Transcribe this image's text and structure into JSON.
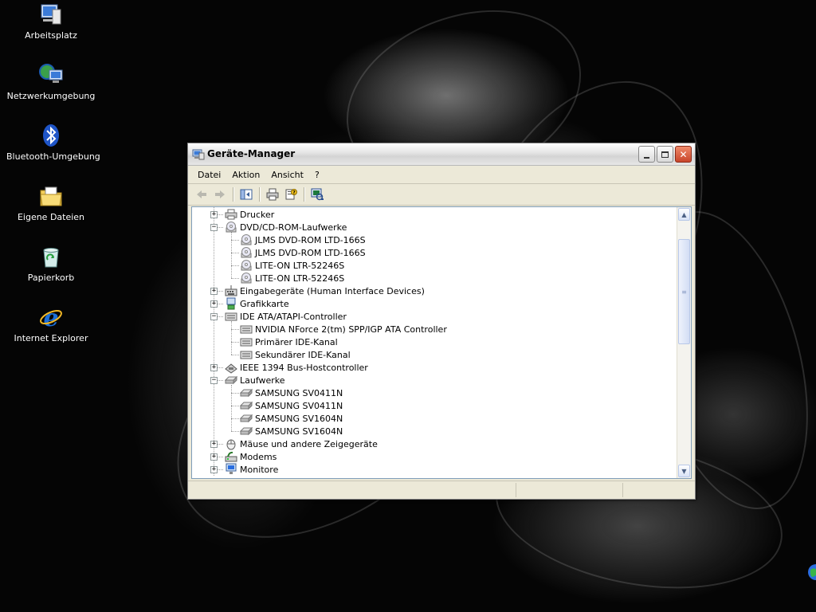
{
  "desktop": {
    "icons": [
      {
        "label": "Arbeitsplatz",
        "icon": "my-computer-icon"
      },
      {
        "label": "Netzwerkumgebung",
        "icon": "network-places-icon"
      },
      {
        "label": "Bluetooth-Umgebung",
        "icon": "bluetooth-icon"
      },
      {
        "label": "Eigene Dateien",
        "icon": "my-documents-icon"
      },
      {
        "label": "Papierkorb",
        "icon": "recycle-bin-icon"
      },
      {
        "label": "Internet Explorer",
        "icon": "internet-explorer-icon"
      }
    ]
  },
  "window": {
    "title": "Geräte-Manager",
    "menu": [
      "Datei",
      "Aktion",
      "Ansicht",
      "?"
    ],
    "toolbar": [
      "back-icon",
      "forward-icon",
      "show-hide-console-tree-icon",
      "print-icon",
      "properties-icon",
      "scan-hardware-icon"
    ],
    "tree": [
      {
        "label": "Drucker",
        "level": 0,
        "expander": "+",
        "icon": "printer-icon"
      },
      {
        "label": "DVD/CD-ROM-Laufwerke",
        "level": 0,
        "expander": "-",
        "icon": "cdrom-icon"
      },
      {
        "label": "JLMS DVD-ROM LTD-166S",
        "level": 1,
        "icon": "cdrom-icon"
      },
      {
        "label": "JLMS DVD-ROM LTD-166S",
        "level": 1,
        "icon": "cdrom-icon"
      },
      {
        "label": "LITE-ON LTR-52246S",
        "level": 1,
        "icon": "cdrom-icon"
      },
      {
        "label": "LITE-ON LTR-52246S",
        "level": 1,
        "icon": "cdrom-icon"
      },
      {
        "label": "Eingabegeräte (Human Interface Devices)",
        "level": 0,
        "expander": "+",
        "icon": "hid-icon"
      },
      {
        "label": "Grafikkarte",
        "level": 0,
        "expander": "+",
        "icon": "display-adapter-icon"
      },
      {
        "label": "IDE ATA/ATAPI-Controller",
        "level": 0,
        "expander": "-",
        "icon": "ide-controller-icon"
      },
      {
        "label": "NVIDIA NForce 2(tm) SPP/IGP ATA Controller",
        "level": 1,
        "icon": "ide-controller-icon"
      },
      {
        "label": "Primärer IDE-Kanal",
        "level": 1,
        "icon": "ide-controller-icon"
      },
      {
        "label": "Sekundärer IDE-Kanal",
        "level": 1,
        "icon": "ide-controller-icon"
      },
      {
        "label": "IEEE 1394 Bus-Hostcontroller",
        "level": 0,
        "expander": "+",
        "icon": "ieee1394-icon"
      },
      {
        "label": "Laufwerke",
        "level": 0,
        "expander": "-",
        "icon": "disk-drive-icon"
      },
      {
        "label": "SAMSUNG SV0411N",
        "level": 1,
        "icon": "disk-drive-icon"
      },
      {
        "label": "SAMSUNG SV0411N",
        "level": 1,
        "icon": "disk-drive-icon"
      },
      {
        "label": "SAMSUNG SV1604N",
        "level": 1,
        "icon": "disk-drive-icon"
      },
      {
        "label": "SAMSUNG SV1604N",
        "level": 1,
        "icon": "disk-drive-icon"
      },
      {
        "label": "Mäuse und andere Zeigegeräte",
        "level": 0,
        "expander": "+",
        "icon": "mouse-icon"
      },
      {
        "label": "Modems",
        "level": 0,
        "expander": "+",
        "icon": "modem-icon"
      },
      {
        "label": "Monitore",
        "level": 0,
        "expander": "+",
        "icon": "monitor-icon"
      }
    ]
  }
}
